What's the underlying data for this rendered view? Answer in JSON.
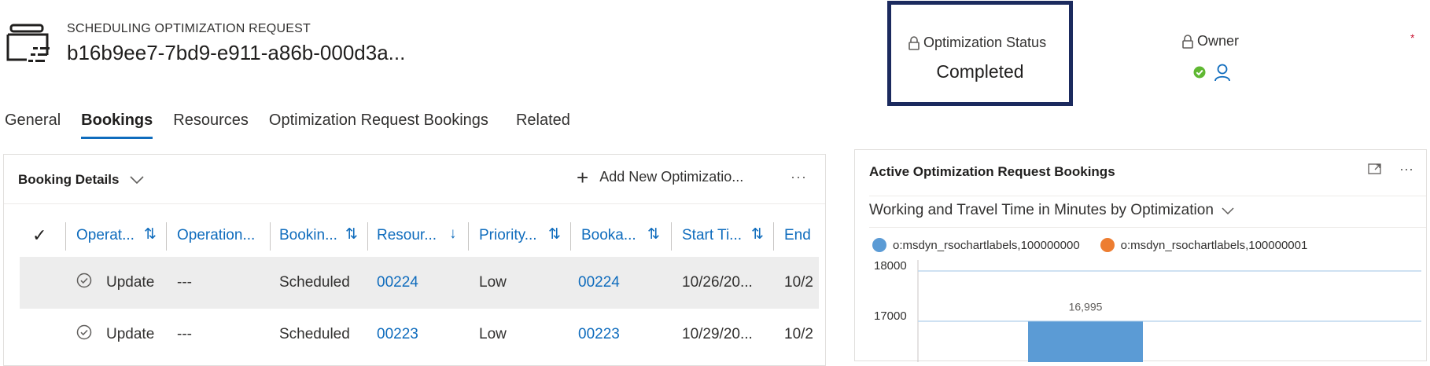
{
  "header": {
    "entity_type": "SCHEDULING OPTIMIZATION REQUEST",
    "record_title": "b16b9ee7-7bd9-e911-a86b-000d3a...",
    "icon": "scheduling-request-icon"
  },
  "status": {
    "label": "Optimization Status",
    "value": "Completed",
    "icon": "lock-icon"
  },
  "owner": {
    "label": "Owner",
    "icon": "lock-icon",
    "presence_color": "#5fb832",
    "required_marker": "*"
  },
  "tabs": [
    {
      "label": "General",
      "active": false
    },
    {
      "label": "Bookings",
      "active": true
    },
    {
      "label": "Resources",
      "active": false
    },
    {
      "label": "Optimization Request Bookings",
      "active": false
    },
    {
      "label": "Related",
      "active": false
    }
  ],
  "grid": {
    "title": "Booking Details",
    "add_label": "Add New Optimizatio...",
    "more_label": "···",
    "columns": [
      {
        "label": "Operat...",
        "sort": "⇅"
      },
      {
        "label": "Operation...",
        "sort": ""
      },
      {
        "label": "Bookin...",
        "sort": "⇅"
      },
      {
        "label": "Resour...",
        "sort": "↓"
      },
      {
        "label": "Priority...",
        "sort": "⇅"
      },
      {
        "label": "Booka...",
        "sort": "⇅"
      },
      {
        "label": "Start Ti...",
        "sort": "⇅"
      },
      {
        "label": "End",
        "sort": ""
      }
    ],
    "rows": [
      {
        "operation": "Update",
        "operation_detail": "---",
        "booking_status": "Scheduled",
        "resource": "00224",
        "priority": "Low",
        "bookable": "00224",
        "start": "10/26/20...",
        "end": "10/2",
        "selected": true
      },
      {
        "operation": "Update",
        "operation_detail": "---",
        "booking_status": "Scheduled",
        "resource": "00223",
        "priority": "Low",
        "bookable": "00223",
        "start": "10/29/20...",
        "end": "10/2",
        "selected": false
      }
    ]
  },
  "chart_panel": {
    "title": "Active Optimization Request Bookings",
    "view_name": "Working and Travel Time in Minutes by Optimization",
    "more_label": "···"
  },
  "chart_data": {
    "type": "bar",
    "series": [
      {
        "name": "o:msdyn_rsochartlabels,100000000",
        "color": "#5b9bd5",
        "values": [
          16995
        ]
      },
      {
        "name": "o:msdyn_rsochartlabels,100000001",
        "color": "#ed7d31",
        "values": []
      }
    ],
    "y_ticks": [
      "18000",
      "17000"
    ],
    "data_labels": [
      "16,995"
    ],
    "ylim_visible": [
      16300,
      18000
    ],
    "grid": true,
    "legend_position": "top"
  }
}
